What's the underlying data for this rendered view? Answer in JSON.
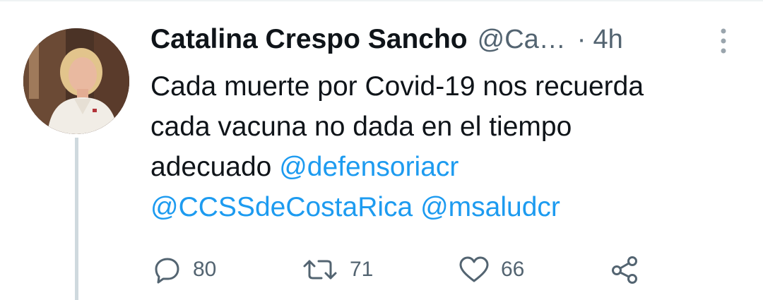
{
  "tweet": {
    "author_name": "Catalina Crespo Sancho",
    "handle": "@Ca…",
    "separator": "·",
    "timestamp": "4h",
    "text_line1": "Cada muerte por Covid-19 nos recuerda",
    "text_line2": "cada vacuna no dada en el tiempo",
    "text_line3_prefix": "adecuado",
    "mentions": [
      "@defensoriacr",
      "@CCSSdeCostaRica",
      "@msaludcr"
    ]
  },
  "actions": {
    "replies": "80",
    "retweets": "71",
    "likes": "66"
  },
  "icons": {
    "more": "more-vertical-icon",
    "reply": "reply-icon",
    "retweet": "retweet-icon",
    "like": "heart-icon",
    "share": "share-icon"
  },
  "colors": {
    "text": "#0f1419",
    "secondary": "#536471",
    "link": "#1d9bf0",
    "thread_line": "#cfd9de"
  }
}
